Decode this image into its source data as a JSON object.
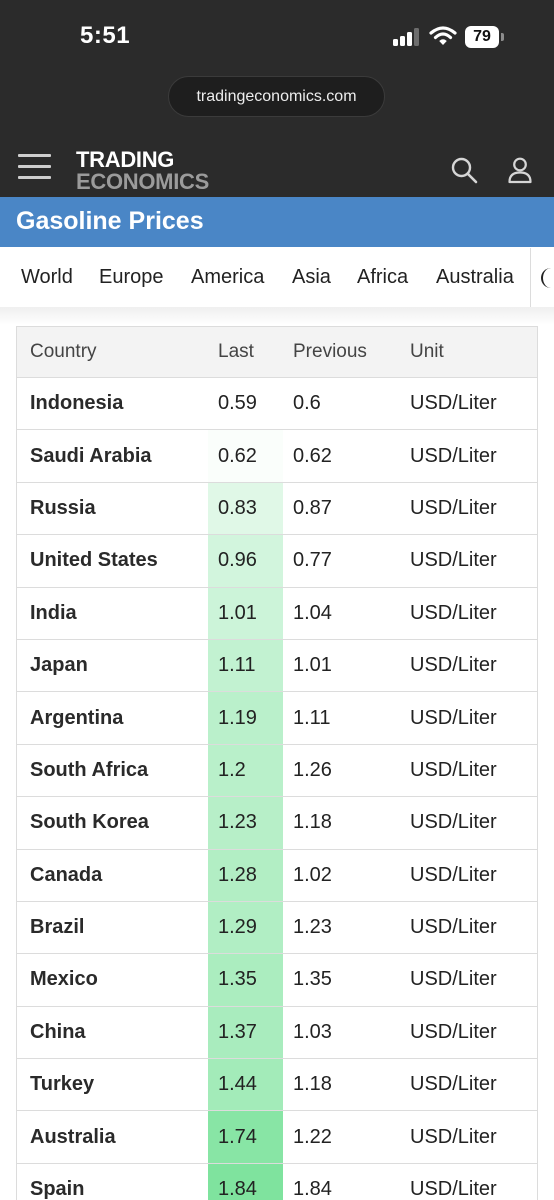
{
  "status_bar": {
    "time": "5:51",
    "battery": "79",
    "icons": [
      "cellular-signal-icon",
      "wifi-icon",
      "battery-icon"
    ]
  },
  "browser": {
    "url": "tradingeconomics.com"
  },
  "site_header": {
    "logo_line1": "TRADING",
    "logo_line2": "ECONOMICS",
    "icons": [
      "hamburger-menu-icon",
      "search-icon",
      "user-icon"
    ]
  },
  "page": {
    "title": "Gasoline Prices"
  },
  "tabs": [
    "World",
    "Europe",
    "America",
    "Asia",
    "Africa",
    "Australia"
  ],
  "table": {
    "headers": {
      "country": "Country",
      "last": "Last",
      "previous": "Previous",
      "unit": "Unit"
    },
    "rows": [
      {
        "country": "Indonesia",
        "last": "0.59",
        "previous": "0.6",
        "unit": "USD/Liter"
      },
      {
        "country": "Saudi Arabia",
        "last": "0.62",
        "previous": "0.62",
        "unit": "USD/Liter"
      },
      {
        "country": "Russia",
        "last": "0.83",
        "previous": "0.87",
        "unit": "USD/Liter"
      },
      {
        "country": "United States",
        "last": "0.96",
        "previous": "0.77",
        "unit": "USD/Liter"
      },
      {
        "country": "India",
        "last": "1.01",
        "previous": "1.04",
        "unit": "USD/Liter"
      },
      {
        "country": "Japan",
        "last": "1.11",
        "previous": "1.01",
        "unit": "USD/Liter"
      },
      {
        "country": "Argentina",
        "last": "1.19",
        "previous": "1.11",
        "unit": "USD/Liter"
      },
      {
        "country": "South Africa",
        "last": "1.2",
        "previous": "1.26",
        "unit": "USD/Liter"
      },
      {
        "country": "South Korea",
        "last": "1.23",
        "previous": "1.18",
        "unit": "USD/Liter"
      },
      {
        "country": "Canada",
        "last": "1.28",
        "previous": "1.02",
        "unit": "USD/Liter"
      },
      {
        "country": "Brazil",
        "last": "1.29",
        "previous": "1.23",
        "unit": "USD/Liter"
      },
      {
        "country": "Mexico",
        "last": "1.35",
        "previous": "1.35",
        "unit": "USD/Liter"
      },
      {
        "country": "China",
        "last": "1.37",
        "previous": "1.03",
        "unit": "USD/Liter"
      },
      {
        "country": "Turkey",
        "last": "1.44",
        "previous": "1.18",
        "unit": "USD/Liter"
      },
      {
        "country": "Australia",
        "last": "1.74",
        "previous": "1.22",
        "unit": "USD/Liter"
      },
      {
        "country": "Spain",
        "last": "1.84",
        "previous": "1.84",
        "unit": "USD/Liter"
      }
    ]
  },
  "colors": {
    "chrome": "#2b2b2b",
    "title_bar": "#4a86c6",
    "last_heat_low": "#ffffff",
    "last_heat_high": "#7fe39e"
  }
}
